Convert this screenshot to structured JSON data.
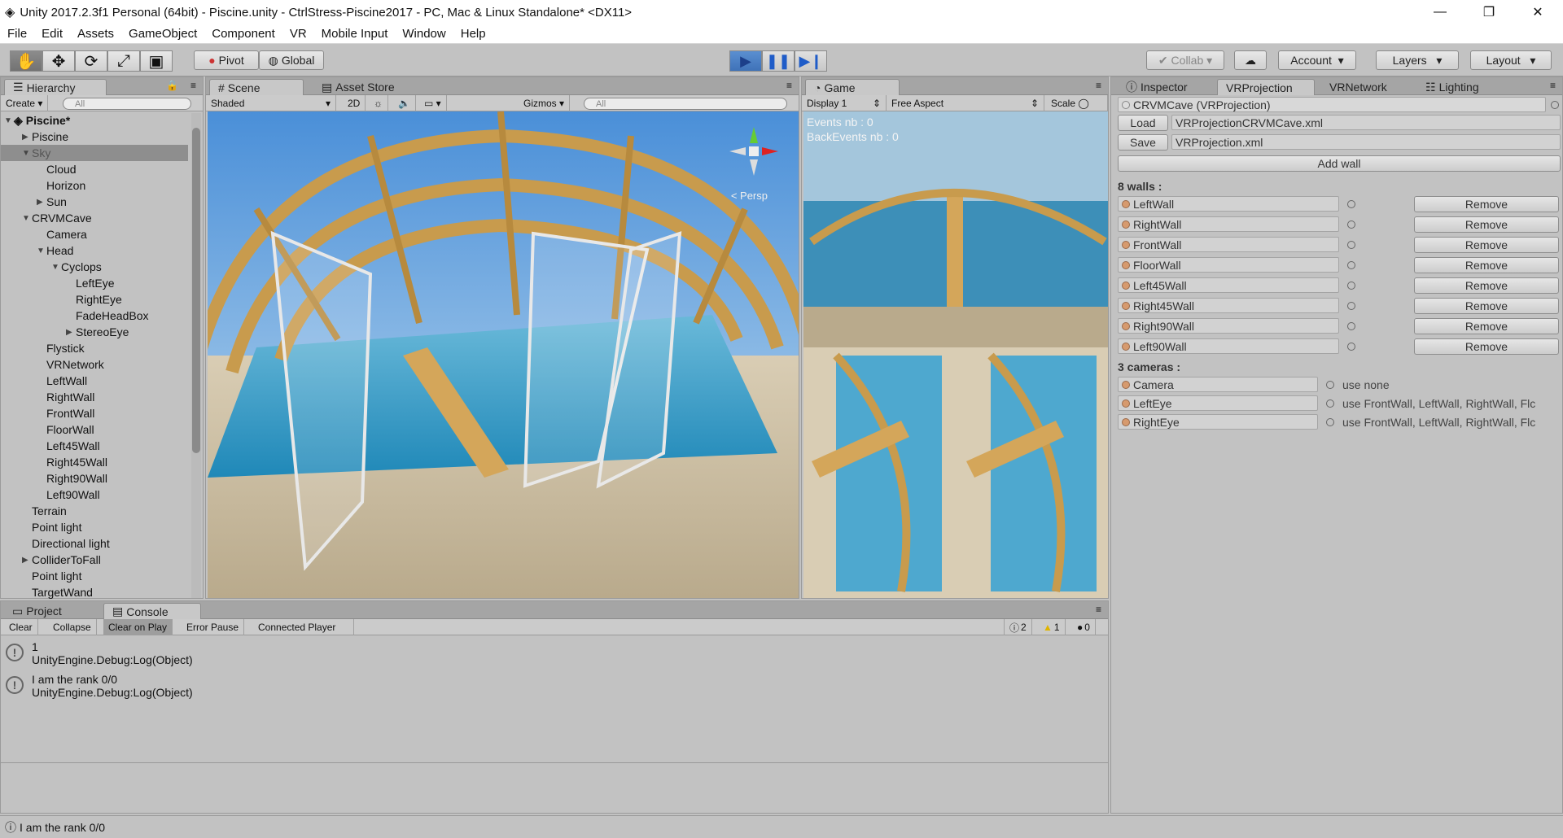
{
  "window": {
    "title": "Unity 2017.2.3f1 Personal (64bit) - Piscine.unity - CtrlStress-Piscine2017 - PC, Mac & Linux Standalone* <DX11>"
  },
  "menu": [
    "File",
    "Edit",
    "Assets",
    "GameObject",
    "Component",
    "VR",
    "Mobile Input",
    "Window",
    "Help"
  ],
  "toolbar": {
    "pivot": "Pivot",
    "global": "Global",
    "collab": "Collab",
    "account": "Account",
    "layers": "Layers",
    "layout": "Layout"
  },
  "hierarchy": {
    "tab": "Hierarchy",
    "create": "Create",
    "search_placeholder": "All",
    "scene": "Piscine*",
    "items": [
      {
        "label": "Piscine",
        "depth": 1,
        "arrow": "right"
      },
      {
        "label": "Sky",
        "depth": 1,
        "arrow": "down",
        "selected": true
      },
      {
        "label": "Cloud",
        "depth": 2
      },
      {
        "label": "Horizon",
        "depth": 2
      },
      {
        "label": "Sun",
        "depth": 2,
        "arrow": "right"
      },
      {
        "label": "CRVMCave",
        "depth": 1,
        "arrow": "down"
      },
      {
        "label": "Camera",
        "depth": 2
      },
      {
        "label": "Head",
        "depth": 2,
        "arrow": "down"
      },
      {
        "label": "Cyclops",
        "depth": 3,
        "arrow": "down"
      },
      {
        "label": "LeftEye",
        "depth": 4
      },
      {
        "label": "RightEye",
        "depth": 4
      },
      {
        "label": "FadeHeadBox",
        "depth": 4
      },
      {
        "label": "StereoEye",
        "depth": 4,
        "arrow": "right"
      },
      {
        "label": "Flystick",
        "depth": 2
      },
      {
        "label": "VRNetwork",
        "depth": 2
      },
      {
        "label": "LeftWall",
        "depth": 2
      },
      {
        "label": "RightWall",
        "depth": 2
      },
      {
        "label": "FrontWall",
        "depth": 2
      },
      {
        "label": "FloorWall",
        "depth": 2
      },
      {
        "label": "Left45Wall",
        "depth": 2
      },
      {
        "label": "Right45Wall",
        "depth": 2
      },
      {
        "label": "Right90Wall",
        "depth": 2
      },
      {
        "label": "Left90Wall",
        "depth": 2
      },
      {
        "label": "Terrain",
        "depth": 1
      },
      {
        "label": "Point light",
        "depth": 1
      },
      {
        "label": "Directional light",
        "depth": 1
      },
      {
        "label": "ColliderToFall",
        "depth": 1,
        "arrow": "right"
      },
      {
        "label": "Point light",
        "depth": 1
      },
      {
        "label": "TargetWand",
        "depth": 1
      }
    ]
  },
  "scene": {
    "tabs": [
      "Scene",
      "Asset Store"
    ],
    "shading": "Shaded",
    "mode2d": "2D",
    "gizmos": "Gizmos",
    "search_placeholder": "All",
    "persp": "Persp"
  },
  "game": {
    "tab": "Game",
    "display": "Display 1",
    "aspect": "Free Aspect",
    "scale": "Scale",
    "events": "Events nb : 0",
    "back_events": "BackEvents nb : 0"
  },
  "inspector": {
    "tabs": [
      "Inspector",
      "VRProjection",
      "VRNetwork",
      "Lighting"
    ],
    "object": "CRVMCave (VRProjection)",
    "load_label": "Load",
    "load_file": "VRProjectionCRVMCave.xml",
    "save_label": "Save",
    "save_file": "VRProjection.xml",
    "add_wall": "Add wall",
    "walls_header": "8 walls :",
    "walls": [
      "LeftWall",
      "RightWall",
      "FrontWall",
      "FloorWall",
      "Left45Wall",
      "Right45Wall",
      "Right90Wall",
      "Left90Wall"
    ],
    "remove_label": "Remove",
    "cameras_header": "3 cameras :",
    "cameras": [
      {
        "name": "Camera",
        "use": "use none"
      },
      {
        "name": "LeftEye",
        "use": "use FrontWall, LeftWall, RightWall, Flc"
      },
      {
        "name": "RightEye",
        "use": "use FrontWall, LeftWall, RightWall, Flc"
      }
    ]
  },
  "console": {
    "tabs": [
      "Project",
      "Console"
    ],
    "buttons": [
      "Clear",
      "Collapse",
      "Clear on Play",
      "Error Pause",
      "Connected Player"
    ],
    "counts": {
      "log": "2",
      "warn": "1",
      "error": "0"
    },
    "entries": [
      {
        "line1": "1",
        "line2": "UnityEngine.Debug:Log(Object)"
      },
      {
        "line1": "I am the rank 0/0",
        "line2": "UnityEngine.Debug:Log(Object)"
      }
    ]
  },
  "status": {
    "text": "I am the rank 0/0"
  }
}
